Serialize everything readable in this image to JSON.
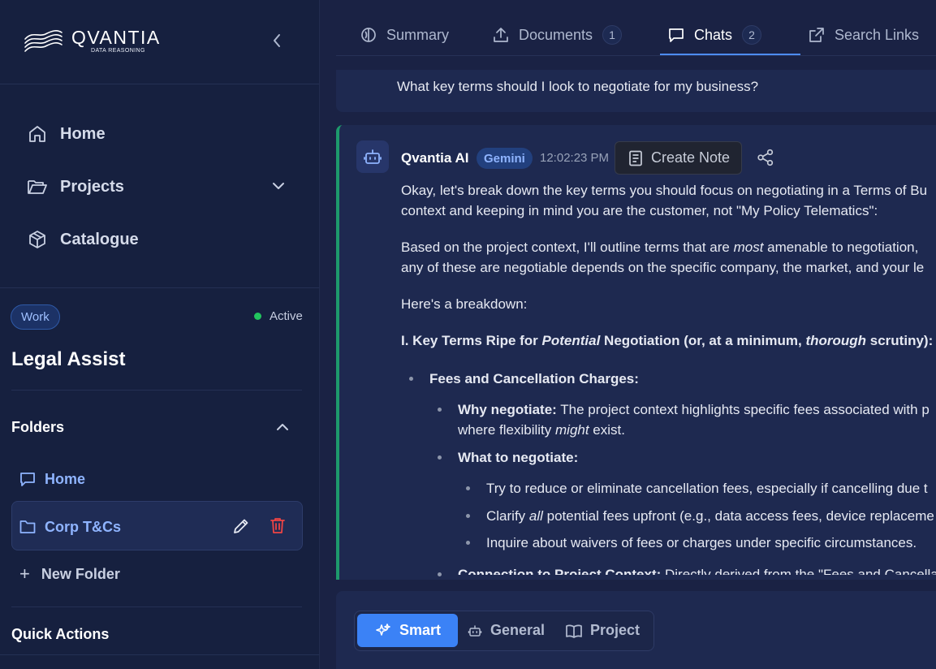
{
  "brand": {
    "name": "QVANTIA",
    "tagline": "DATA REASONING"
  },
  "nav": {
    "home": "Home",
    "projects": "Projects",
    "catalogue": "Catalogue"
  },
  "project": {
    "tag": "Work",
    "status": "Active",
    "title": "Legal Assist"
  },
  "folders": {
    "heading": "Folders",
    "items": [
      {
        "label": "Home"
      },
      {
        "label": "Corp T&Cs"
      }
    ],
    "new_folder": "New Folder"
  },
  "quick_actions": "Quick Actions",
  "tabs": [
    {
      "label": "Summary"
    },
    {
      "label": "Documents",
      "count": "1"
    },
    {
      "label": "Chats",
      "count": "2"
    },
    {
      "label": "Search Links"
    }
  ],
  "user_message": "What key terms should I look to negotiate for my business?",
  "ai_message": {
    "author": "Qvantia AI",
    "model": "Gemini",
    "time": "12:02:23 PM",
    "create_note": "Create Note",
    "p1_line1": "Okay, let's break down the key terms you should focus on negotiating in a Terms of Bu",
    "p1_line2": "context and keeping in mind you are the customer, not \"My Policy Telematics\":",
    "p2_line1_a": "Based on the project context, I'll outline terms that are ",
    "p2_line1_em": "most",
    "p2_line1_b": " amenable to negotiation,",
    "p2_line2": "any of these are negotiable depends on the specific company, the market, and your le",
    "p3": "Here's a breakdown:",
    "h1_a": "I. Key Terms Ripe for ",
    "h1_em": "Potential",
    "h1_b": " Negotiation (or, at a minimum, ",
    "h1_em2": "thorough",
    "h1_c": " scrutiny):",
    "b1": "Fees and Cancellation Charges:",
    "b1_1_bold": "Why negotiate:",
    "b1_1_text": " The project context highlights specific fees associated with p",
    "b1_1_line2_a": "where flexibility ",
    "b1_1_line2_em": "might",
    "b1_1_line2_b": " exist.",
    "b1_2": "What to negotiate:",
    "b1_2_1": "Try to reduce or eliminate cancellation fees, especially if cancelling due t",
    "b1_2_2_a": "Clarify ",
    "b1_2_2_em": "all",
    "b1_2_2_b": " potential fees upfront (e.g., data access fees, device replaceme",
    "b1_2_3": "Inquire about waivers of fees or charges under specific circumstances.",
    "b1_3_bold": "Connection to Project Context:",
    "b1_3_text": " Directly derived from the \"Fees and Cancella"
  },
  "composer": {
    "modes": [
      {
        "label": "Smart"
      },
      {
        "label": "General"
      },
      {
        "label": "Project"
      }
    ]
  }
}
